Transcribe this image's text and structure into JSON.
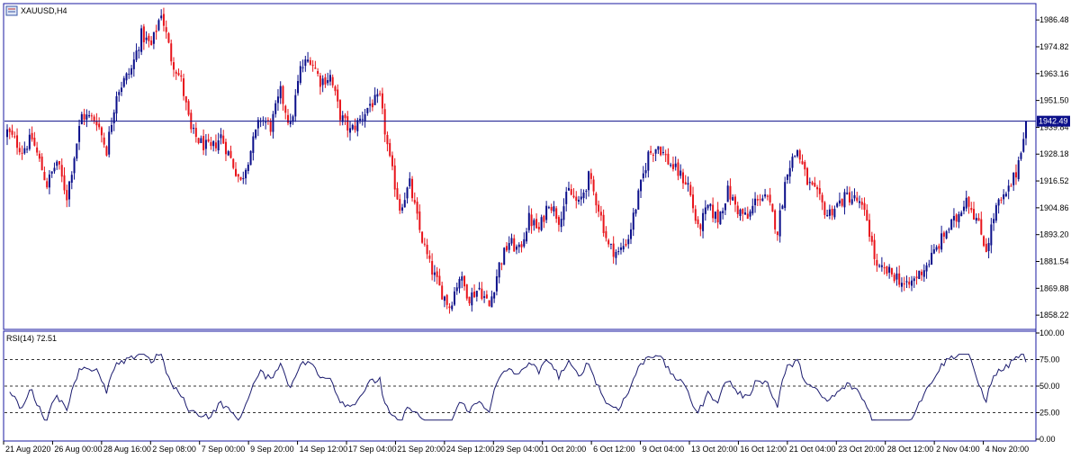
{
  "window": {
    "symbol_label": "XAUUSD,H4",
    "icon": "chart-window-icon"
  },
  "colors": {
    "bull": "#0b0f8a",
    "bear": "#e8141b",
    "line": "#0b0f8a",
    "frame": "#1a1aa0",
    "current_price_bg": "#0b0f8a",
    "rsi_line": "#1b1b6e"
  },
  "chart_data": [
    {
      "type": "candlestick",
      "title": "XAUUSD,H4",
      "price_axis_ticks": [
        "1986.48",
        "1974.82",
        "1963.16",
        "1951.50",
        "1939.84",
        "1928.18",
        "1916.52",
        "1904.86",
        "1893.20",
        "1881.54",
        "1869.88",
        "1858.22"
      ],
      "price_axis_values": [
        1986.48,
        1974.82,
        1963.16,
        1951.5,
        1939.84,
        1928.18,
        1916.52,
        1904.86,
        1893.2,
        1881.54,
        1869.88,
        1858.22
      ],
      "ylim": [
        1852.8,
        1992.8
      ],
      "current_price": 1942.49,
      "current_price_label": "1942.49",
      "time_axis_labels": [
        "21 Aug 2020",
        "26 Aug 00:00",
        "28 Aug 16:00",
        "2 Sep 08:00",
        "7 Sep 00:00",
        "9 Sep 20:00",
        "14 Sep 12:00",
        "17 Sep 04:00",
        "21 Sep 20:00",
        "24 Sep 12:00",
        "29 Sep 04:00",
        "1 Oct 20:00",
        "6 Oct 12:00",
        "9 Oct 04:00",
        "13 Oct 20:00",
        "16 Oct 12:00",
        "21 Oct 04:00",
        "23 Oct 20:00",
        "28 Oct 12:00",
        "2 Nov 04:00",
        "4 Nov 20:00"
      ],
      "close_path": [
        [
          0,
          1938
        ],
        [
          6,
          1930
        ],
        [
          10,
          1935
        ],
        [
          16,
          1915
        ],
        [
          20,
          1925
        ],
        [
          24,
          1910
        ],
        [
          30,
          1945
        ],
        [
          36,
          1943
        ],
        [
          40,
          1930
        ],
        [
          44,
          1955
        ],
        [
          50,
          1965
        ],
        [
          54,
          1980
        ],
        [
          58,
          1975
        ],
        [
          62,
          1990
        ],
        [
          66,
          1970
        ],
        [
          70,
          1960
        ],
        [
          74,
          1938
        ],
        [
          78,
          1933
        ],
        [
          82,
          1930
        ],
        [
          86,
          1936
        ],
        [
          90,
          1926
        ],
        [
          94,
          1916
        ],
        [
          98,
          1930
        ],
        [
          102,
          1944
        ],
        [
          106,
          1940
        ],
        [
          110,
          1955
        ],
        [
          114,
          1940
        ],
        [
          118,
          1965
        ],
        [
          122,
          1970
        ],
        [
          126,
          1960
        ],
        [
          130,
          1962
        ],
        [
          134,
          1945
        ],
        [
          138,
          1938
        ],
        [
          142,
          1943
        ],
        [
          146,
          1950
        ],
        [
          150,
          1952
        ],
        [
          154,
          1925
        ],
        [
          158,
          1905
        ],
        [
          162,
          1915
        ],
        [
          166,
          1895
        ],
        [
          170,
          1880
        ],
        [
          174,
          1870
        ],
        [
          178,
          1862
        ],
        [
          182,
          1875
        ],
        [
          186,
          1866
        ],
        [
          190,
          1870
        ],
        [
          194,
          1862
        ],
        [
          198,
          1880
        ],
        [
          202,
          1890
        ],
        [
          206,
          1886
        ],
        [
          210,
          1900
        ],
        [
          214,
          1895
        ],
        [
          218,
          1908
        ],
        [
          222,
          1900
        ],
        [
          226,
          1912
        ],
        [
          230,
          1906
        ],
        [
          234,
          1918
        ],
        [
          238,
          1905
        ],
        [
          242,
          1888
        ],
        [
          246,
          1885
        ],
        [
          250,
          1892
        ],
        [
          254,
          1910
        ],
        [
          258,
          1928
        ],
        [
          262,
          1932
        ],
        [
          266,
          1925
        ],
        [
          270,
          1920
        ],
        [
          274,
          1915
        ],
        [
          278,
          1895
        ],
        [
          282,
          1905
        ],
        [
          286,
          1900
        ],
        [
          290,
          1912
        ],
        [
          294,
          1904
        ],
        [
          298,
          1900
        ],
        [
          302,
          1910
        ],
        [
          306,
          1908
        ],
        [
          310,
          1895
        ],
        [
          314,
          1922
        ],
        [
          318,
          1930
        ],
        [
          322,
          1916
        ],
        [
          326,
          1910
        ],
        [
          330,
          1902
        ],
        [
          334,
          1906
        ],
        [
          338,
          1910
        ],
        [
          342,
          1908
        ],
        [
          346,
          1900
        ],
        [
          350,
          1878
        ],
        [
          354,
          1877
        ],
        [
          358,
          1875
        ],
        [
          362,
          1870
        ],
        [
          366,
          1875
        ],
        [
          370,
          1880
        ],
        [
          374,
          1887
        ],
        [
          378,
          1895
        ],
        [
          382,
          1900
        ],
        [
          386,
          1910
        ],
        [
          390,
          1900
        ],
        [
          394,
          1887
        ],
        [
          398,
          1905
        ],
        [
          402,
          1910
        ],
        [
          406,
          1920
        ],
        [
          410,
          1942.49
        ]
      ],
      "n_candles": 411
    },
    {
      "type": "line",
      "title": "RSI(14) 72.51",
      "indicator": "RSI",
      "period": 14,
      "last_value": 72.51,
      "ylim": [
        0,
        100
      ],
      "axis_ticks": [
        "100.00",
        "75.00",
        "50.00",
        "25.00",
        "0.00"
      ],
      "axis_values": [
        100,
        75,
        50,
        25,
        0
      ],
      "levels": [
        75,
        50,
        25
      ]
    }
  ]
}
